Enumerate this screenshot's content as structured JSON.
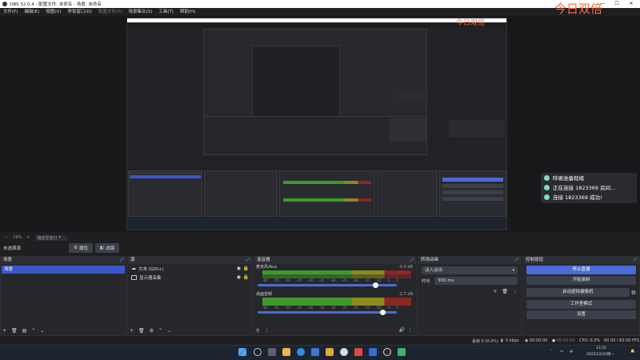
{
  "window": {
    "title": "OBS 32.0.4 - 配置文件: 未命名 - 场景: 未命名",
    "minimize": "—",
    "maximize": "☐",
    "close": "✕"
  },
  "menu": [
    {
      "label": "文件(F)",
      "enabled": true
    },
    {
      "label": "编辑(E)",
      "enabled": true
    },
    {
      "label": "视图(V)",
      "enabled": true
    },
    {
      "label": "停靠窗口(D)",
      "enabled": true
    },
    {
      "label": "配置文件(P)",
      "enabled": false
    },
    {
      "label": "场景集合(S)",
      "enabled": true
    },
    {
      "label": "工具(T)",
      "enabled": true
    },
    {
      "label": "帮助(H)",
      "enabled": true
    }
  ],
  "preview": {
    "watermark": "今日双倍",
    "nested_watermark": "今日双倍"
  },
  "notifications": [
    "呼唤准备就绪",
    "正在连接 1823369 房间...",
    "连接 1823369 成功!"
  ],
  "zoom": {
    "label": "19%",
    "fit_label": "缩放至窗口"
  },
  "scene_toolbar": {
    "no_selection": "未选择源",
    "properties": "属性",
    "filters": "滤镜"
  },
  "docks": {
    "scenes": {
      "title": "场景",
      "items": [
        "场景"
      ]
    },
    "sources": {
      "title": "源",
      "items": [
        {
          "name": "文本 (GDI+)",
          "icon": "text-icon"
        },
        {
          "name": "显示器采集",
          "icon": "monitor-icon"
        }
      ]
    },
    "mixer": {
      "title": "混音器",
      "channels": [
        {
          "name": "麦克风/Aux",
          "db": "-0.0 dB",
          "volume": 0.85
        },
        {
          "name": "桌面音频",
          "db": "-2.7 dB",
          "volume": 0.9
        }
      ],
      "ticks": [
        "-60",
        "-55",
        "-50",
        "-45",
        "-40",
        "-35",
        "-30",
        "-25",
        "-20",
        "-15",
        "-10",
        "-5",
        "0"
      ]
    },
    "transitions": {
      "title": "转场动画",
      "selected": "淡入淡出",
      "duration_label": "时长",
      "duration_value": "300 ms"
    },
    "controls": {
      "title": "控制按钮",
      "buttons": [
        "停止直播",
        "开始录制",
        "启动虚拟摄像机",
        "工作室模式",
        "设置"
      ]
    }
  },
  "status": {
    "frames": "丢帧 0 (0.0%)",
    "bitrate": "0 kbps",
    "live": "00:00:00",
    "rec": "00:00:00",
    "cpu": "CPU: 0.3%",
    "fps": "60.00 / 60.00 FPS"
  },
  "taskbar": {
    "time": "13:35",
    "date": "2025/12/29周一"
  },
  "colors": {
    "accent": "#4a6bd8",
    "scene_selected": "#3a57c9",
    "meter_green": "#3e9a2a",
    "meter_yellow": "#8c8a1e",
    "meter_red": "#8a2626",
    "notify_dot": "#7fdcc4",
    "watermark": "#ff6a3c"
  }
}
